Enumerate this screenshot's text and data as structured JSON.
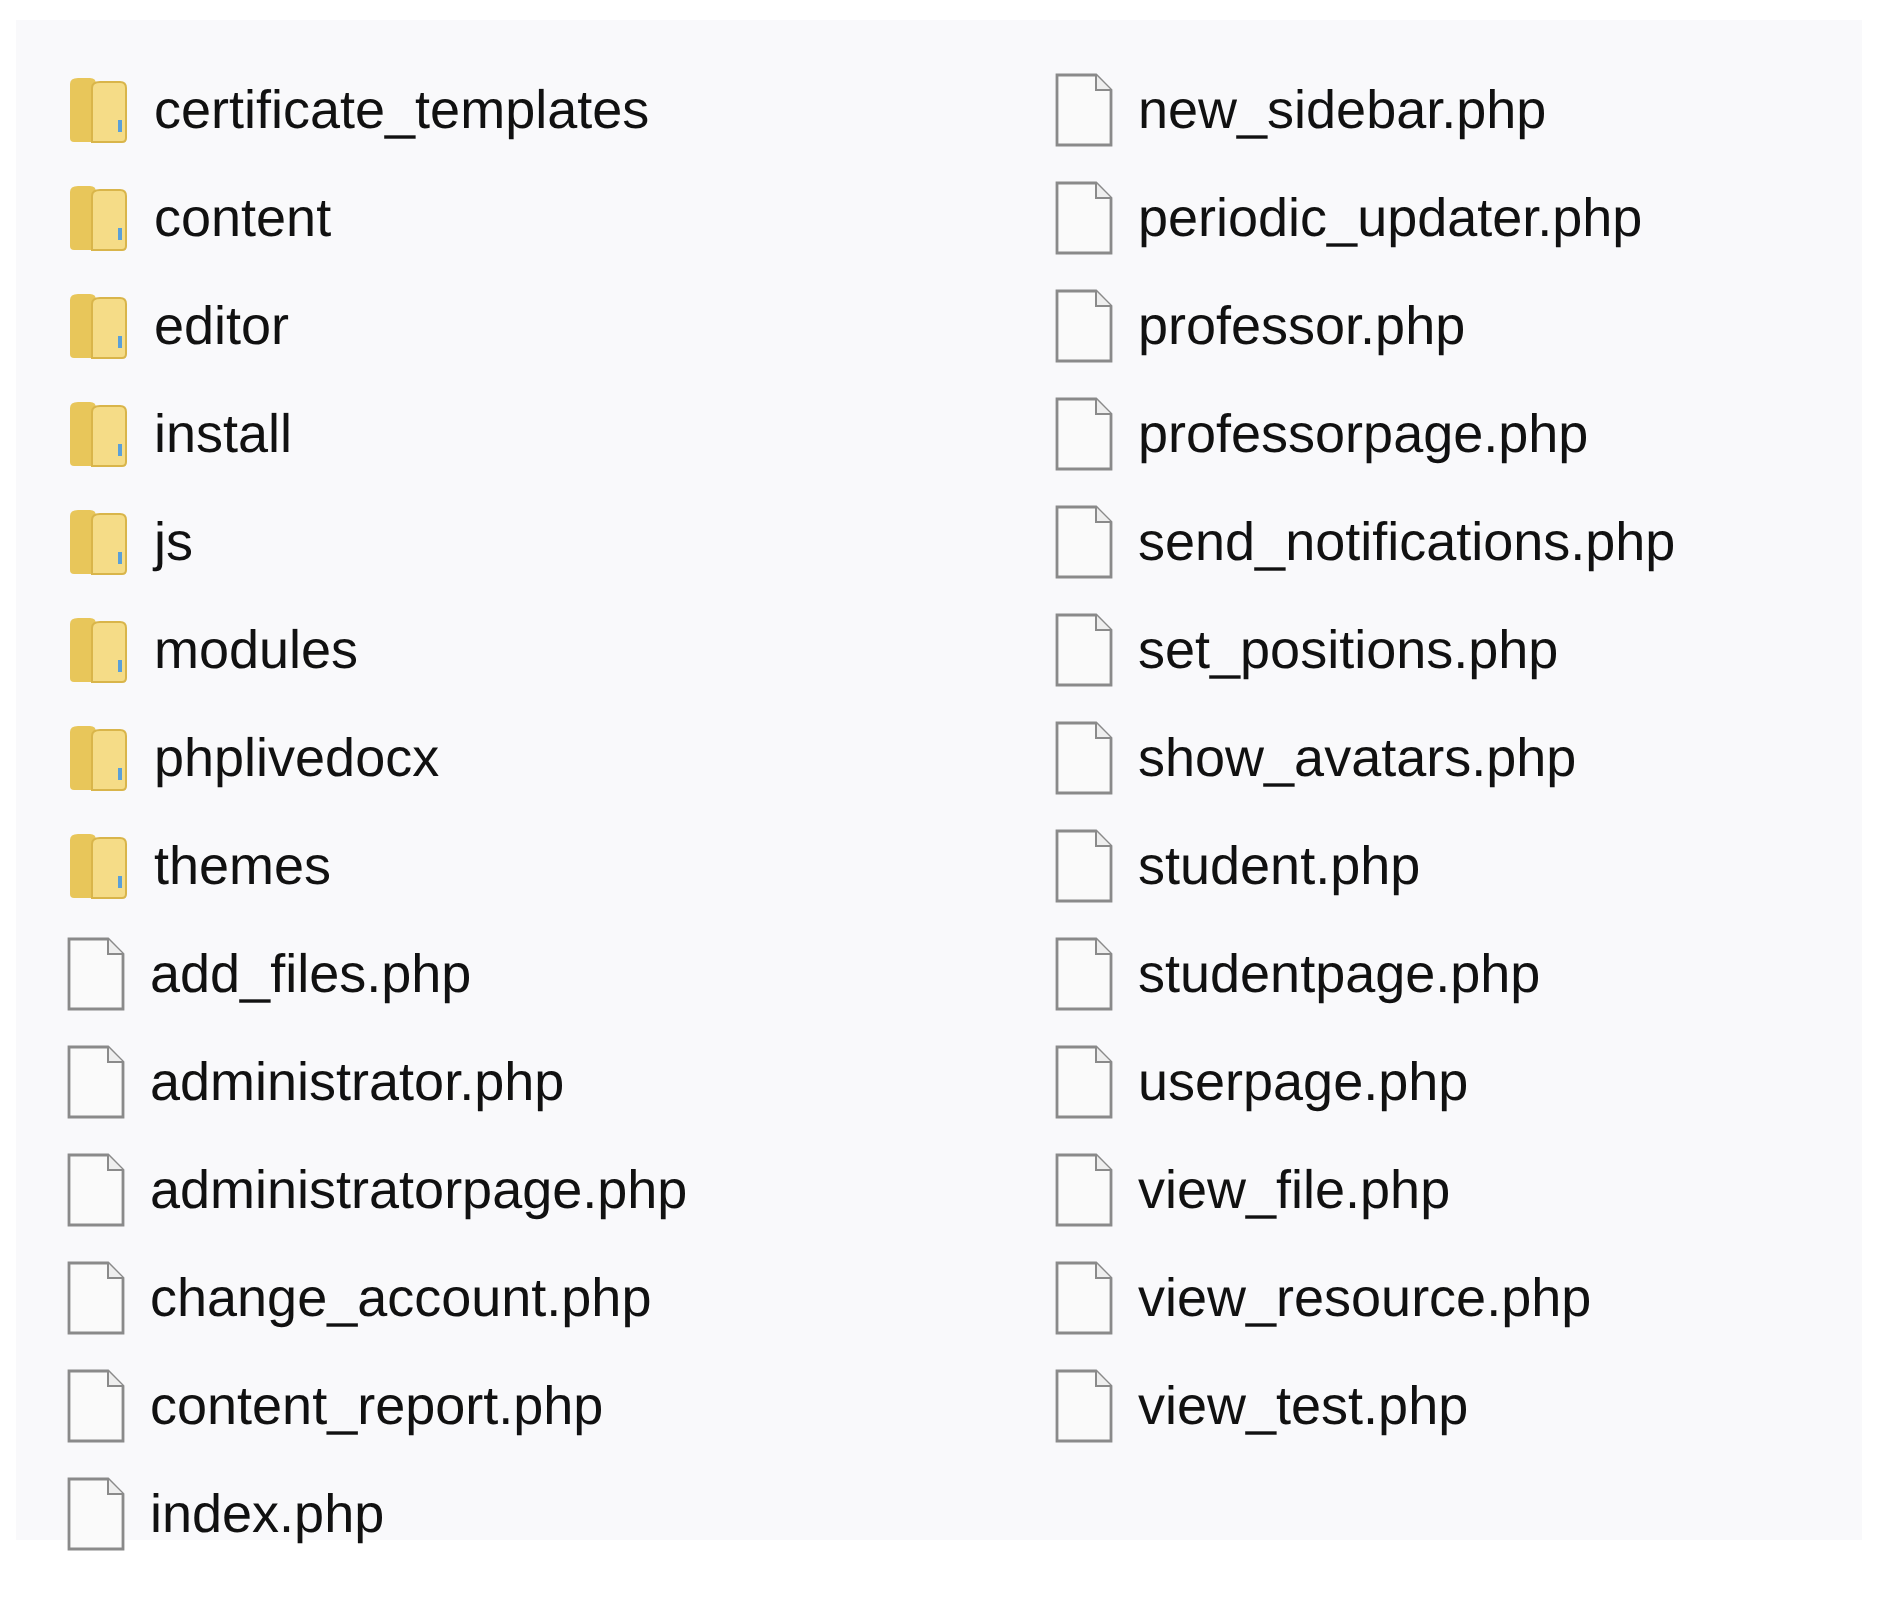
{
  "columns": [
    [
      {
        "kind": "folder",
        "name": "certificate_templates"
      },
      {
        "kind": "folder",
        "name": "content"
      },
      {
        "kind": "folder",
        "name": "editor"
      },
      {
        "kind": "folder",
        "name": "install"
      },
      {
        "kind": "folder",
        "name": "js"
      },
      {
        "kind": "folder",
        "name": "modules"
      },
      {
        "kind": "folder",
        "name": "phplivedocx"
      },
      {
        "kind": "folder",
        "name": "themes"
      },
      {
        "kind": "file",
        "name": "add_files.php"
      },
      {
        "kind": "file",
        "name": "administrator.php"
      },
      {
        "kind": "file",
        "name": "administratorpage.php"
      },
      {
        "kind": "file",
        "name": "change_account.php"
      },
      {
        "kind": "file",
        "name": "content_report.php"
      },
      {
        "kind": "file",
        "name": "index.php"
      }
    ],
    [
      {
        "kind": "file",
        "name": "new_sidebar.php"
      },
      {
        "kind": "file",
        "name": "periodic_updater.php"
      },
      {
        "kind": "file",
        "name": "professor.php"
      },
      {
        "kind": "file",
        "name": "professorpage.php"
      },
      {
        "kind": "file",
        "name": "send_notifications.php"
      },
      {
        "kind": "file",
        "name": "set_positions.php"
      },
      {
        "kind": "file",
        "name": "show_avatars.php"
      },
      {
        "kind": "file",
        "name": "student.php"
      },
      {
        "kind": "file",
        "name": "studentpage.php"
      },
      {
        "kind": "file",
        "name": "userpage.php"
      },
      {
        "kind": "file",
        "name": "view_file.php"
      },
      {
        "kind": "file",
        "name": "view_resource.php"
      },
      {
        "kind": "file",
        "name": "view_test.php"
      }
    ]
  ]
}
